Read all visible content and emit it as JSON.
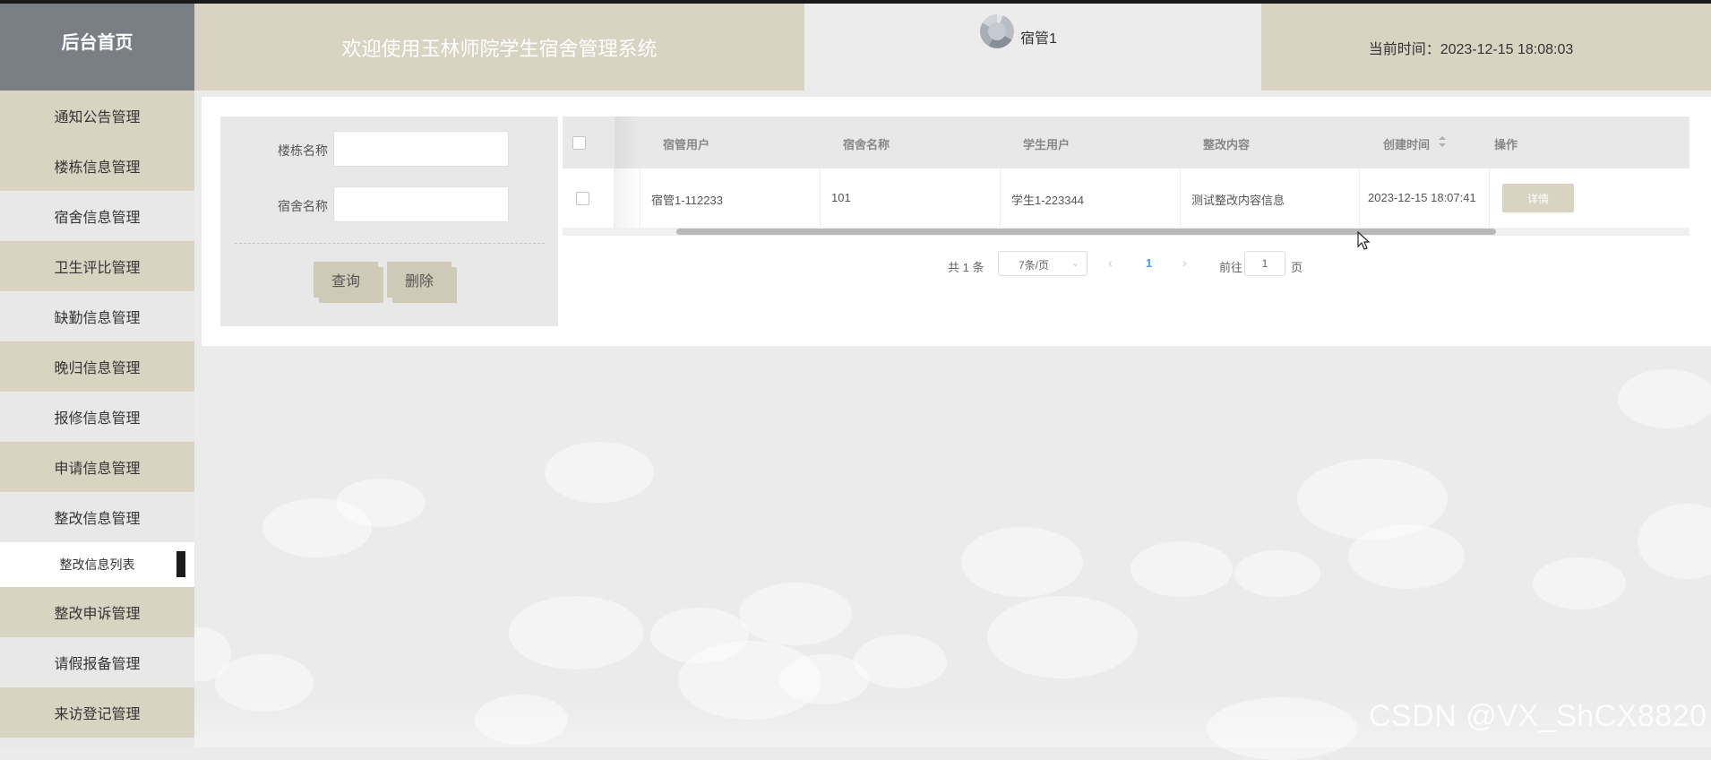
{
  "header": {
    "home_label": "后台首页",
    "title": "欢迎使用玉林师院学生宿舍管理系统",
    "username": "宿管1",
    "current_time": "当前时间：2023-12-15 18:08:03"
  },
  "sidebar": {
    "items": [
      {
        "label": "通知公告管理"
      },
      {
        "label": "楼栋信息管理"
      },
      {
        "label": "宿舍信息管理"
      },
      {
        "label": "卫生评比管理"
      },
      {
        "label": "缺勤信息管理"
      },
      {
        "label": "晚归信息管理"
      },
      {
        "label": "报修信息管理"
      },
      {
        "label": "申请信息管理"
      },
      {
        "label": "整改信息管理"
      }
    ],
    "active_sub": "整改信息列表",
    "items_after": [
      {
        "label": "整改申诉管理"
      },
      {
        "label": "请假报备管理"
      },
      {
        "label": "来访登记管理"
      }
    ]
  },
  "search": {
    "building_label": "楼栋名称",
    "building_value": "",
    "dorm_label": "宿舍名称",
    "dorm_value": "",
    "query_button": "查询",
    "delete_button": "删除"
  },
  "table": {
    "columns": [
      "宿管用户",
      "宿舍名称",
      "学生用户",
      "整改内容",
      "创建时间",
      "操作"
    ],
    "rows": [
      {
        "manager": "宿管1-112233",
        "dorm": "101",
        "student": "学生1-223344",
        "content": "测试整改内容信息",
        "created": "2023-12-15 18:07:41",
        "action": "详情"
      }
    ]
  },
  "pagination": {
    "total": "共 1 条",
    "page_size": "7条/页",
    "current_page": "1",
    "goto_label": "前往",
    "goto_value": "1",
    "page_suffix": "页"
  },
  "watermark": "CSDN @VX_ShCX8820",
  "colors": {
    "accent": "#d9d3c2",
    "home_bg": "#7a7e85",
    "page_bg": "#ebebeb",
    "link": "#409eff"
  }
}
